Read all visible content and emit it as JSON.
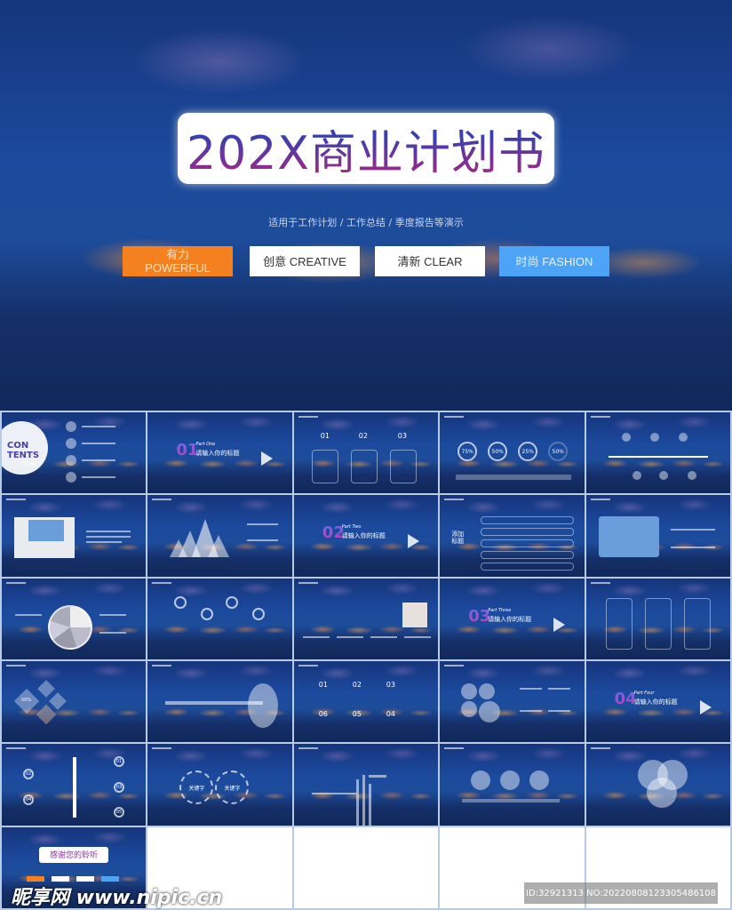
{
  "hero": {
    "title": "202X商业计划书",
    "subtitle": "适用于工作计划 / 工作总结 / 季度报告等演示",
    "tags": [
      {
        "cn": "有力",
        "en": "POWERFUL",
        "color": "#f5801f"
      },
      {
        "label": "创意 CREATIVE"
      },
      {
        "label": "清新 CLEAR"
      },
      {
        "label": "时尚 FASHION",
        "color": "#4da3f5"
      }
    ]
  },
  "slides": {
    "contents": {
      "title_line1": "CON",
      "title_line2": "TENTS"
    },
    "sections": [
      {
        "num": "01",
        "part": "Part One",
        "title": "请输入你的标题"
      },
      {
        "num": "02",
        "part": "Part Two",
        "title": "请输入你的标题"
      },
      {
        "num": "03",
        "part": "Part Three",
        "title": "请输入你的标题"
      },
      {
        "num": "04",
        "part": "Part Four",
        "title": "请输入你的标题"
      }
    ],
    "cards": [
      "01",
      "02",
      "03"
    ],
    "rings": [
      "75%",
      "50%",
      "25%",
      "50%"
    ],
    "add_title": "添加标题",
    "diamond_value": "50%",
    "steps": [
      "01",
      "02",
      "03",
      "06",
      "05",
      "04"
    ],
    "timeline_nums": [
      "01",
      "02",
      "03",
      "04",
      "05"
    ],
    "keywords": [
      "关键字",
      "关键字"
    ],
    "thanks": "感谢您的聆听"
  },
  "watermark": {
    "logo": "昵享网 www.nipic.cn",
    "id": "ID:32921313 NO:20220808123305486108"
  }
}
